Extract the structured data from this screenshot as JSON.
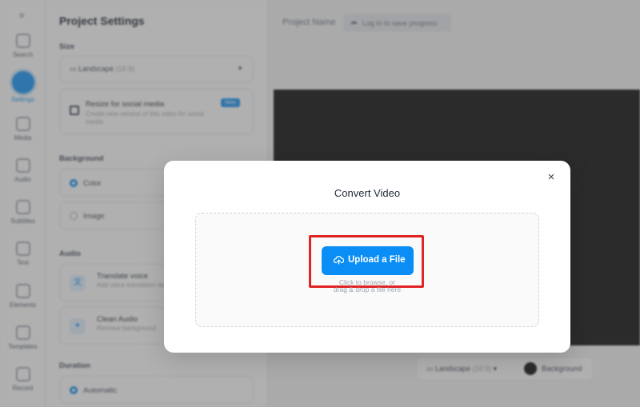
{
  "rail": {
    "items": [
      {
        "label": "Search",
        "icon": "search-icon"
      },
      {
        "label": "Settings",
        "icon": "settings-icon",
        "active": true
      },
      {
        "label": "Media",
        "icon": "media-icon"
      },
      {
        "label": "Audio",
        "icon": "audio-icon"
      },
      {
        "label": "Subtitles",
        "icon": "subtitles-icon"
      },
      {
        "label": "Text",
        "icon": "text-icon"
      },
      {
        "label": "Elements",
        "icon": "elements-icon"
      },
      {
        "label": "Templates",
        "icon": "templates-icon"
      },
      {
        "label": "Record",
        "icon": "record-icon"
      }
    ]
  },
  "panel": {
    "title": "Project Settings",
    "size": {
      "label": "Size",
      "value": "Landscape",
      "ratio": "(16:9)"
    },
    "resize": {
      "title": "Resize for social media",
      "description": "Create new version of this video for social media",
      "badge": "New"
    },
    "background": {
      "label": "Background",
      "options": [
        "Color",
        "Image"
      ],
      "selected": "Color"
    },
    "audio": {
      "label": "Audio",
      "items": [
        {
          "title": "Translate voice",
          "description": "Add voice translation languages"
        },
        {
          "title": "Clean Audio",
          "description": "Remove background"
        }
      ]
    },
    "duration": {
      "label": "Duration",
      "option": "Automatic"
    }
  },
  "main": {
    "project_name_label": "Project Name",
    "login_text": "Log in to save progress",
    "bottombar": {
      "size_value": "Landscape",
      "size_ratio": "(16:9)",
      "background_label": "Background"
    }
  },
  "modal": {
    "title": "Convert Video",
    "close_symbol": "×",
    "upload_label": "Upload a File",
    "hint_line1": "Click to browse, or",
    "hint_line2": "drag & drop a file here"
  },
  "colors": {
    "accent": "#0a8ef5",
    "highlight": "#e02424"
  }
}
